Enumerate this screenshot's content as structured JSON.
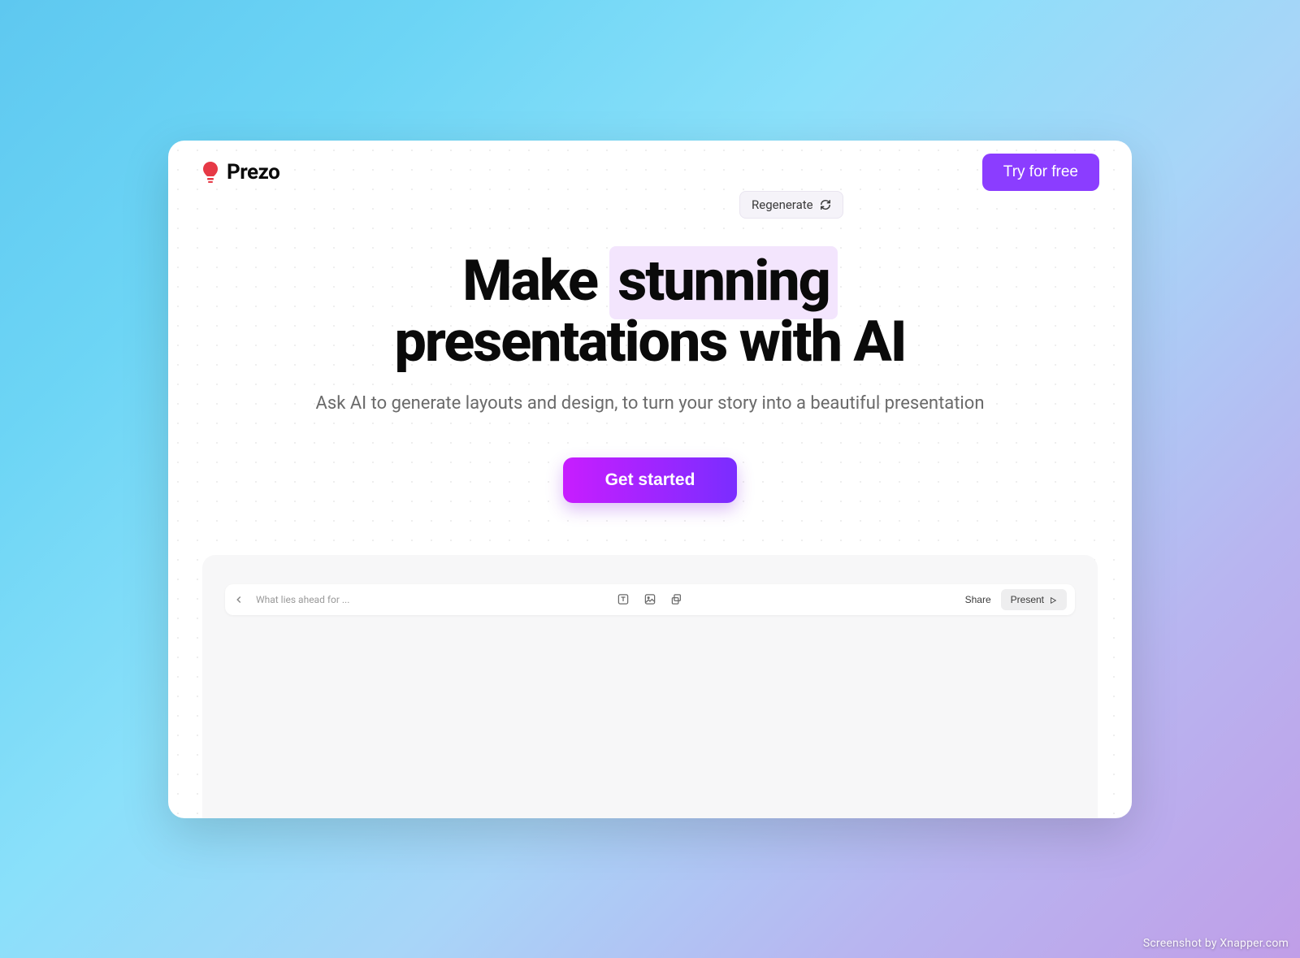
{
  "brand": {
    "name": "Prezo"
  },
  "header": {
    "try_free_label": "Try for free"
  },
  "hero": {
    "regenerate_label": "Regenerate",
    "headline_prefix": "Make ",
    "headline_highlight": "stunning",
    "headline_line2": "presentations with AI",
    "subheadline": "Ask AI to generate layouts and design, to turn your story into a beautiful presentation",
    "cta_label": "Get started"
  },
  "preview": {
    "title": "What lies ahead for ...",
    "share_label": "Share",
    "present_label": "Present"
  },
  "watermark": "Screenshot by Xnapper.com"
}
